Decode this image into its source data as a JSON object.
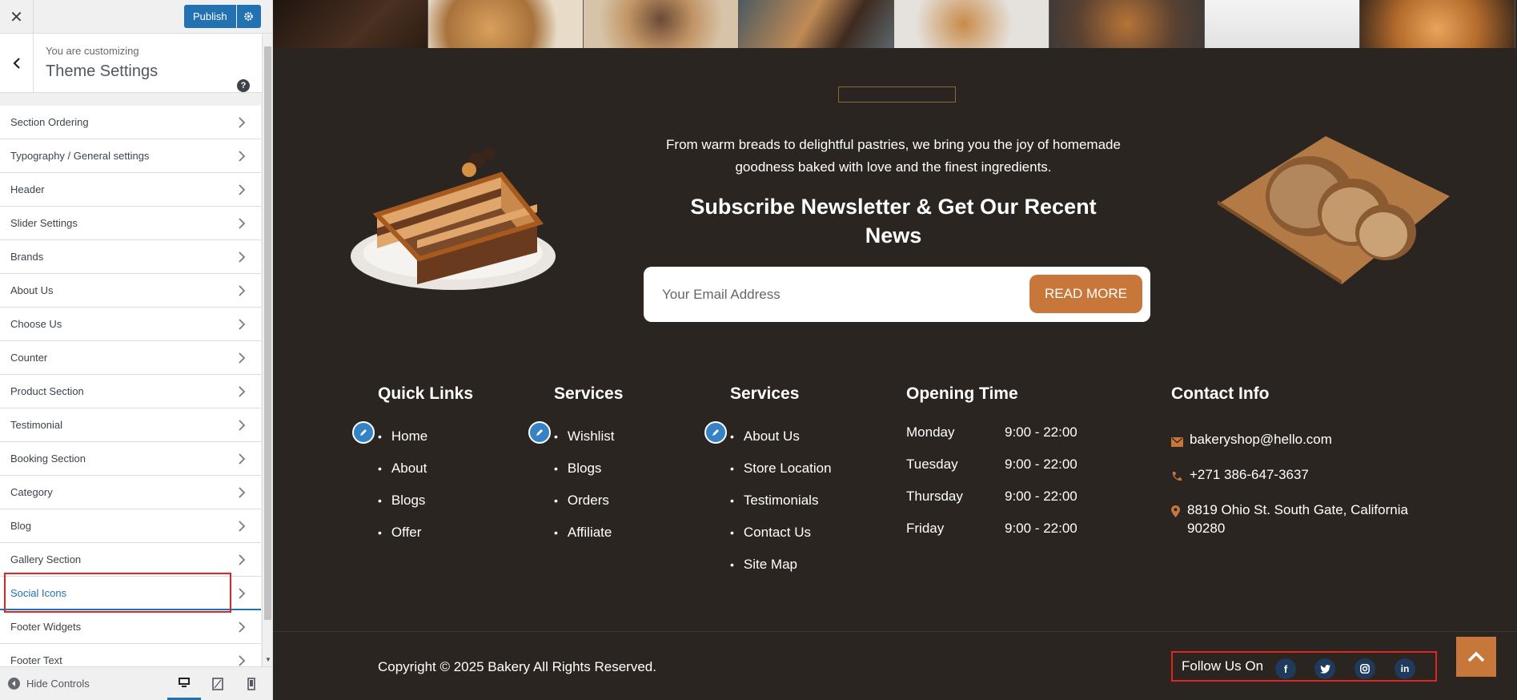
{
  "customizer": {
    "publish_label": "Publish",
    "customizing_label": "You are customizing",
    "panel_title": "Theme Settings",
    "menu_items": [
      "Section Ordering",
      "Typography / General settings",
      "Header",
      "Slider Settings",
      "Brands",
      "About Us",
      "Choose Us",
      "Counter",
      "Product Section",
      "Testimonial",
      "Booking Section",
      "Category",
      "Blog",
      "Gallery Section",
      "Social Icons",
      "Footer Widgets",
      "Footer Text"
    ],
    "active_item": "Social Icons",
    "hide_controls_label": "Hide Controls",
    "accent_color": "#2271b1"
  },
  "preview": {
    "tagline": "From warm breads to delightful pastries, we bring you the joy of homemade goodness baked with love and the finest ingredients.",
    "newsletter_title": "Subscribe Newsletter & Get Our Recent News",
    "email_placeholder": "Your Email Address",
    "read_more_label": "READ MORE",
    "quick_links": {
      "title": "Quick Links",
      "items": [
        "Home",
        "About",
        "Blogs",
        "Offer"
      ]
    },
    "services_1": {
      "title": "Services",
      "items": [
        "Wishlist",
        "Blogs",
        "Orders",
        "Affiliate"
      ]
    },
    "services_2": {
      "title": "Services",
      "items": [
        "About Us",
        "Store Location",
        "Testimonials",
        "Contact Us",
        "Site Map"
      ]
    },
    "opening_time": {
      "title": "Opening Time",
      "rows": [
        {
          "day": "Monday",
          "hours": "9:00 - 22:00"
        },
        {
          "day": "Tuesday",
          "hours": "9:00 - 22:00"
        },
        {
          "day": "Thursday",
          "hours": "9:00 - 22:00"
        },
        {
          "day": "Friday",
          "hours": "9:00 - 22:00"
        }
      ]
    },
    "contact_info": {
      "title": "Contact Info",
      "email": "bakeryshop@hello.com",
      "phone": "+271 386-647-3637",
      "address": "8819 Ohio St. South Gate, California 90280"
    },
    "copyright": "Copyright © 2025 Bakery All Rights Reserved.",
    "follow_label": "Follow Us On",
    "social_icons": [
      "facebook-icon",
      "twitter-icon",
      "instagram-icon",
      "linkedin-icon"
    ],
    "accent_color": "#c8773a",
    "background_color": "#2a2521"
  }
}
